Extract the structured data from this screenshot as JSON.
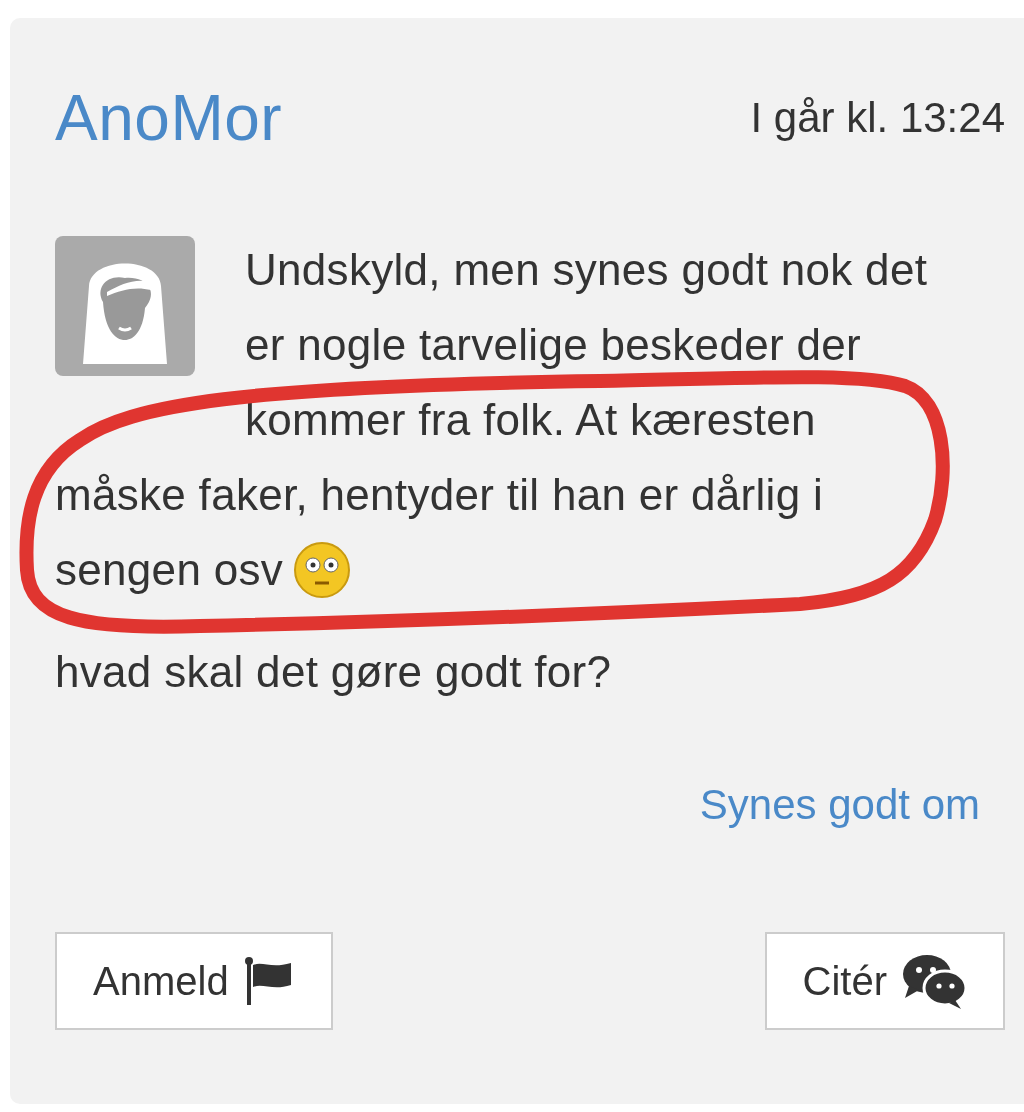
{
  "post": {
    "author": "AnoMor",
    "time": "I går kl. 13:24",
    "body": [
      "Undskyld, men synes godt nok det",
      "er nogle tarvelige beskeder der",
      "kommer fra folk. At kæresten",
      "måske faker, hentyder til han er dårlig i",
      "sengen osv",
      "hvad skal det gøre godt for?"
    ],
    "like_link": "Synes godt om",
    "buttons": [
      {
        "label": "Anmeld",
        "kind": "report"
      },
      {
        "label": "Citér",
        "kind": "quote"
      }
    ]
  }
}
